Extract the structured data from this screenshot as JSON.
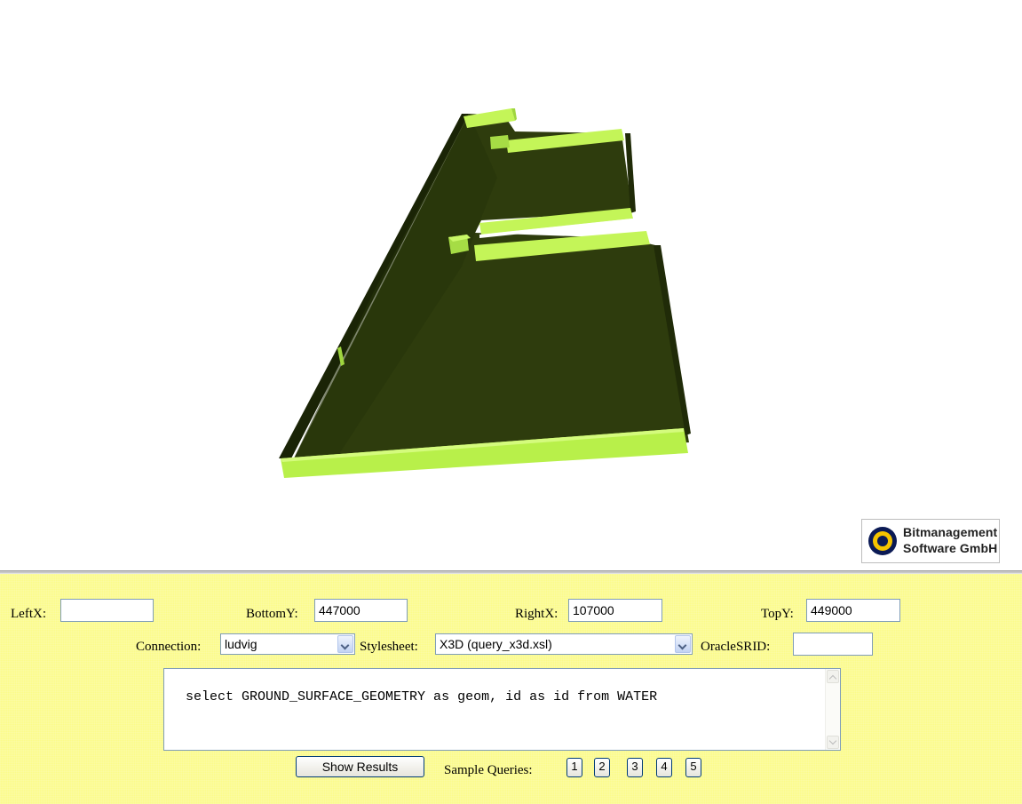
{
  "logo": {
    "line1": "Bitmanagement",
    "line2": "Software GmbH"
  },
  "controls": {
    "leftx_label": "LeftX:",
    "leftx_value": "",
    "bottomy_label": "BottomY:",
    "bottomy_value": "447000",
    "rightx_label": "RightX:",
    "rightx_value": "107000",
    "topy_label": "TopY:",
    "topy_value": "449000",
    "connection_label": "Connection:",
    "connection_value": "ludvig",
    "stylesheet_label": "Stylesheet:",
    "stylesheet_value": "X3D (query_x3d.xsl)",
    "oraclesrid_label": "OracleSRID:",
    "oraclesrid_value": "",
    "query_text": "select GROUND_SURFACE_GEOMETRY as geom, id as id from WATER",
    "show_results_label": "Show Results",
    "sample_queries_label": "Sample Queries:",
    "sample_buttons": [
      "1",
      "2",
      "3",
      "4",
      "5"
    ]
  },
  "colors": {
    "panel_background": "#fbfb8a",
    "model_top_face": "#2f3d0c",
    "model_side_face": "#b8f04a",
    "logo_ring": "#f5c400",
    "logo_dark": "#0b1a55"
  }
}
